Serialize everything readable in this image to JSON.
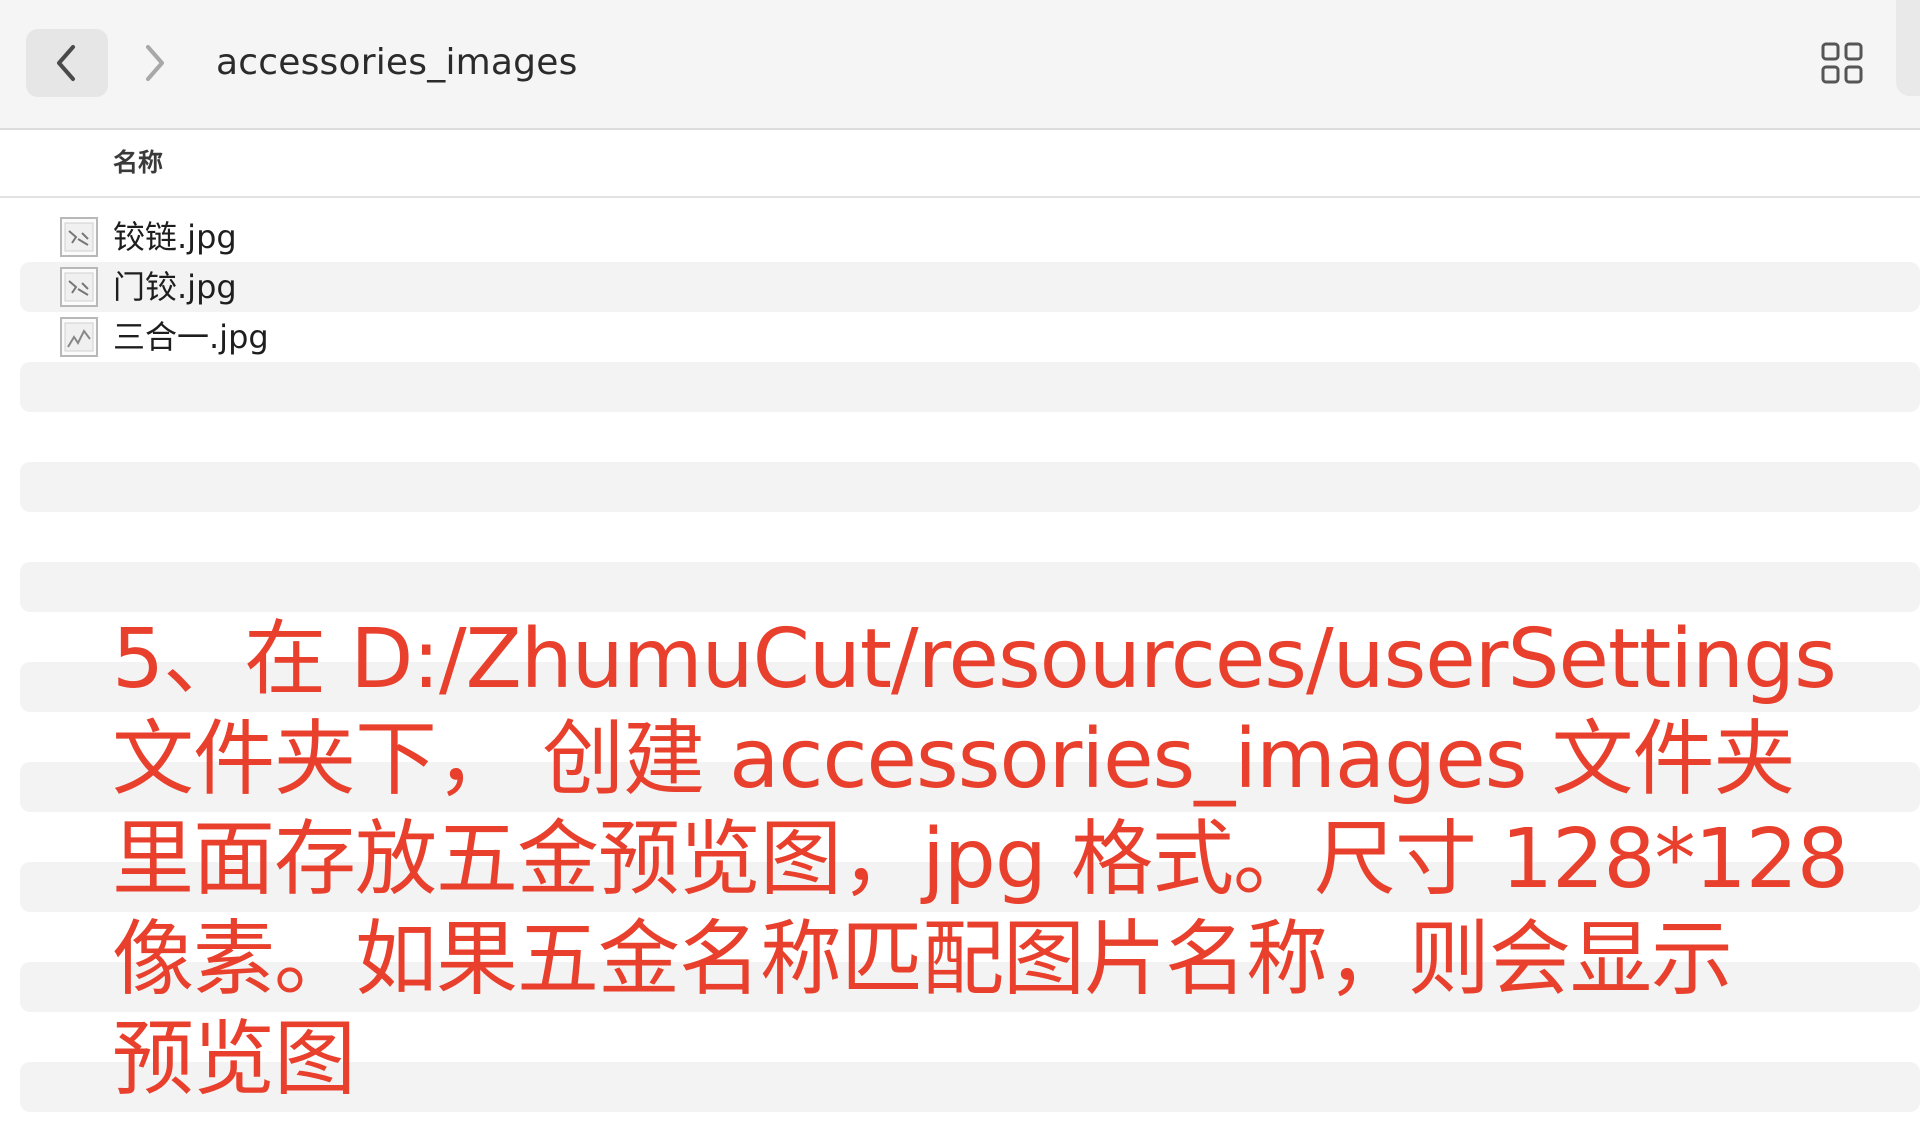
{
  "toolbar": {
    "title": "accessories_images",
    "back_icon": "chevron-left-icon",
    "forward_icon": "chevron-right-icon",
    "view_icon": "grid-view-icon"
  },
  "columns": {
    "name": "名称"
  },
  "files": [
    {
      "name": "铰链.jpg",
      "icon": "image-file-icon"
    },
    {
      "name": "门铰.jpg",
      "icon": "image-file-icon"
    },
    {
      "name": "三合一.jpg",
      "icon": "image-file-icon"
    }
  ],
  "annotation": {
    "lines": [
      "5、在 D:/ZhumuCut/resources/userSettings",
      "文件夹下， 创建 accessories_images 文件夹",
      "里面存放五金预览图，jpg 格式。尺寸 128*128",
      "像素。如果五金名称匹配图片名称，则会显示",
      "预览图"
    ]
  },
  "colors": {
    "annotation_text": "#e8402c",
    "toolbar_bg": "#f5f5f5",
    "stripe_bg": "#f3f3f3"
  }
}
